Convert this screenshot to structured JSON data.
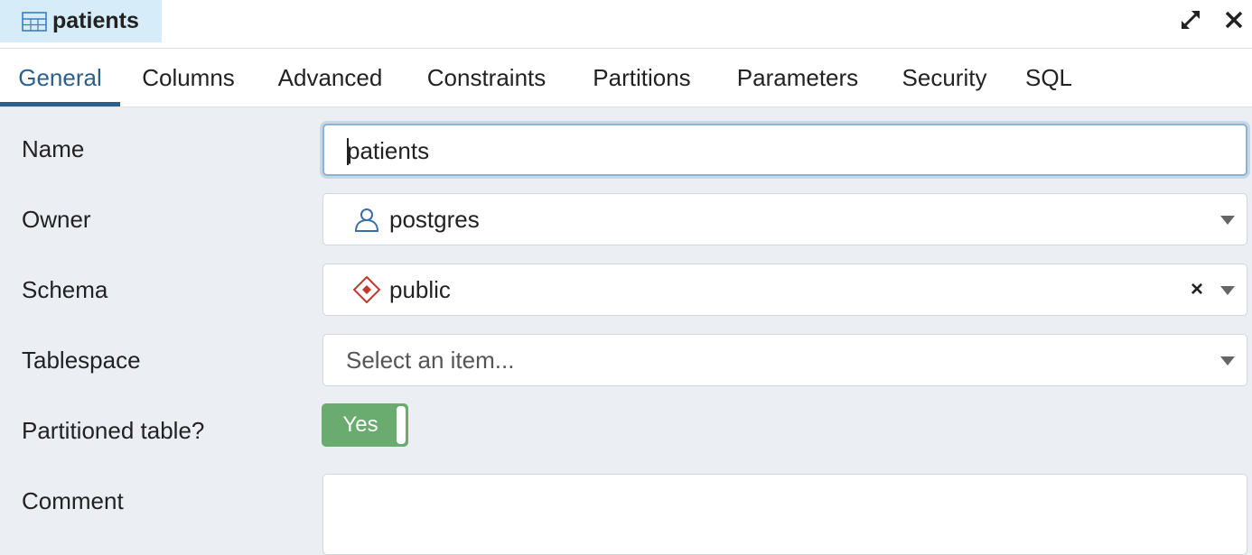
{
  "window": {
    "title": "patients",
    "title_icon": "table-icon",
    "controls": [
      "expand-icon",
      "close-icon"
    ]
  },
  "tabs": [
    {
      "label": "General",
      "active": true
    },
    {
      "label": "Columns",
      "active": false
    },
    {
      "label": "Advanced",
      "active": false
    },
    {
      "label": "Constraints",
      "active": false
    },
    {
      "label": "Partitions",
      "active": false
    },
    {
      "label": "Parameters",
      "active": false
    },
    {
      "label": "Security",
      "active": false
    },
    {
      "label": "SQL",
      "active": false
    }
  ],
  "form": {
    "name": {
      "label": "Name",
      "value": "patients"
    },
    "owner": {
      "label": "Owner",
      "value": "postgres",
      "icon": "user-icon"
    },
    "schema": {
      "label": "Schema",
      "value": "public",
      "icon": "schema-icon",
      "clear_glyph": "×"
    },
    "tablespace": {
      "label": "Tablespace",
      "placeholder": "Select an item..."
    },
    "partitioned": {
      "label": "Partitioned table?",
      "toggle_text": "Yes",
      "checked": true
    },
    "comment": {
      "label": "Comment",
      "value": ""
    }
  },
  "colors": {
    "accent": "#2c5f8a",
    "title_tab_bg": "#d6ecf8",
    "toggle_on": "#6aab6f",
    "schema_icon": "#c0392b",
    "user_icon": "#3a6ea5"
  }
}
